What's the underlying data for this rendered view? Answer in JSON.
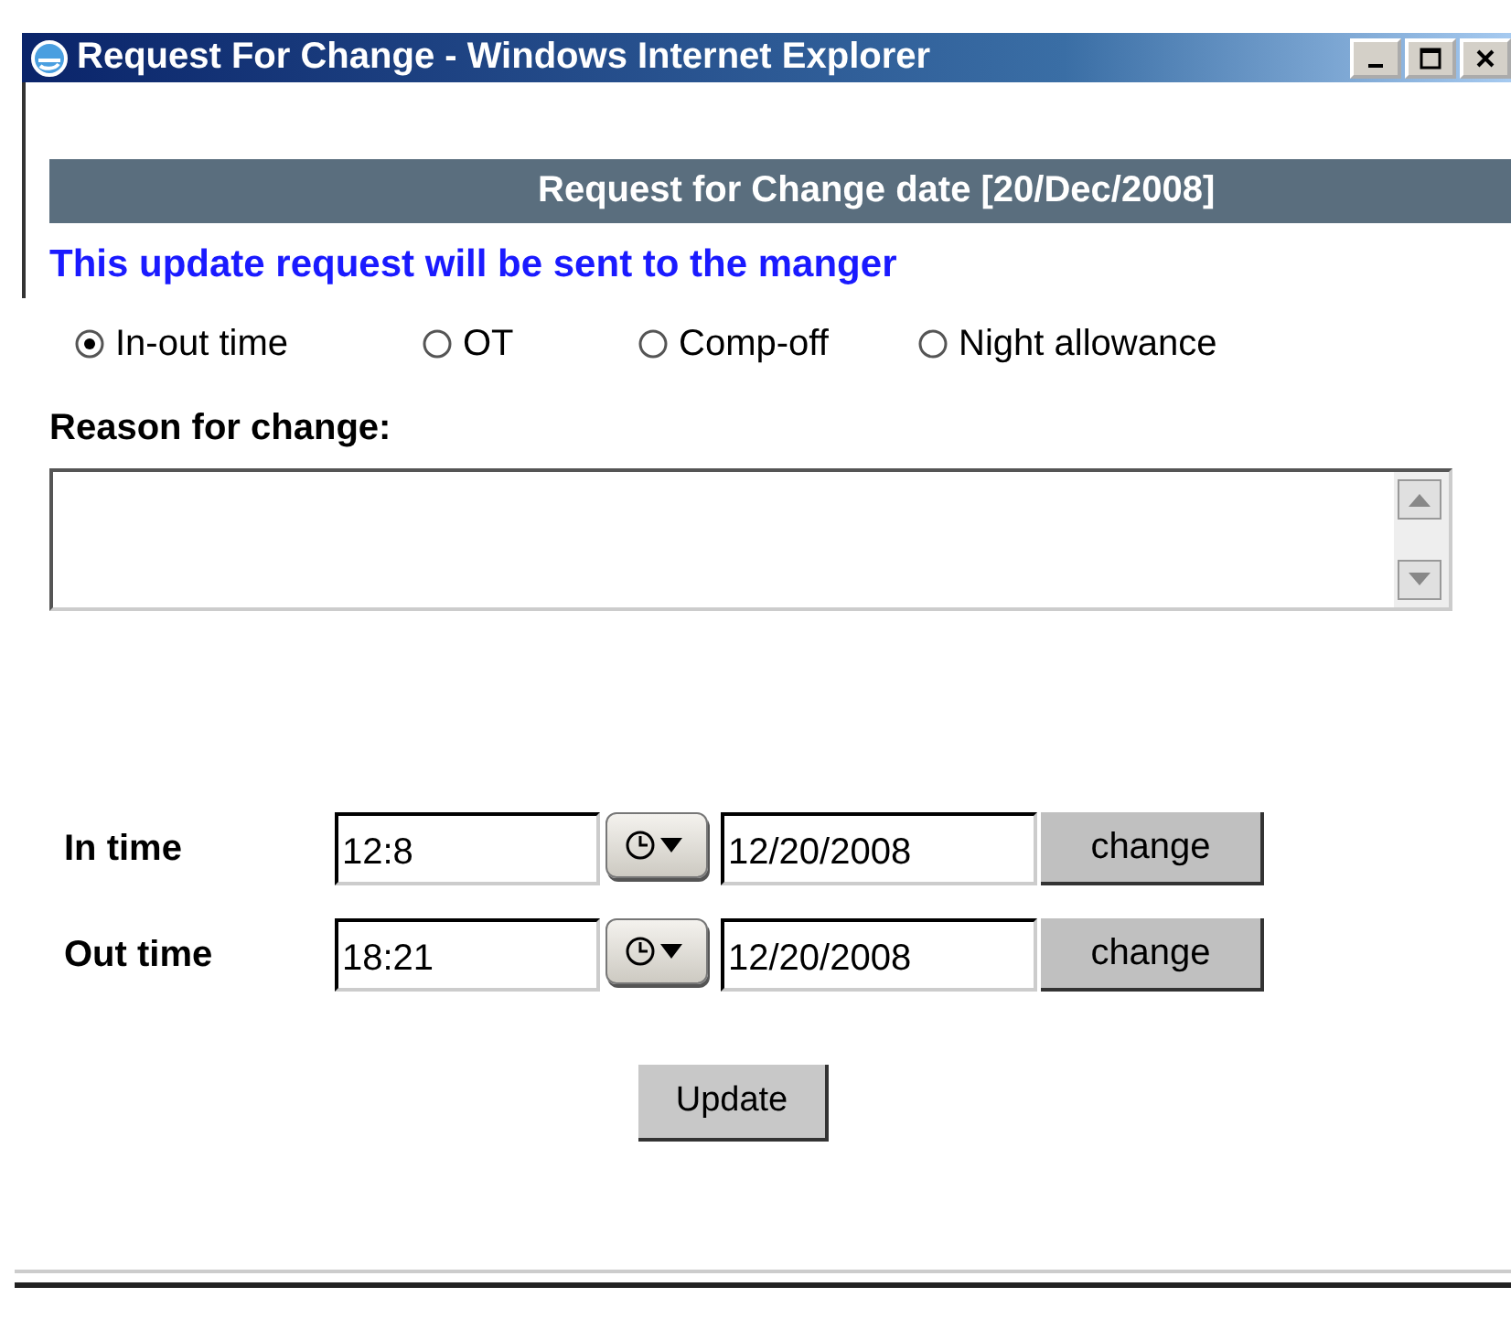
{
  "window": {
    "title": "Request For Change - Windows Internet Explorer"
  },
  "header": {
    "title": "Request for Change date [20/Dec/2008]"
  },
  "notice": "This update request will be sent to the manger",
  "change_types": [
    {
      "label": "In-out time",
      "selected": true
    },
    {
      "label": "OT",
      "selected": false
    },
    {
      "label": "Comp-off",
      "selected": false
    },
    {
      "label": "Night allowance",
      "selected": false
    }
  ],
  "reason": {
    "label": "Reason for change:"
  },
  "times": [
    {
      "label": "In time",
      "time": "12:8",
      "date": "12/20/2008",
      "button": "change"
    },
    {
      "label": "Out time",
      "time": "18:21",
      "date": "12/20/2008",
      "button": "change"
    }
  ],
  "buttons": [
    "Update"
  ]
}
